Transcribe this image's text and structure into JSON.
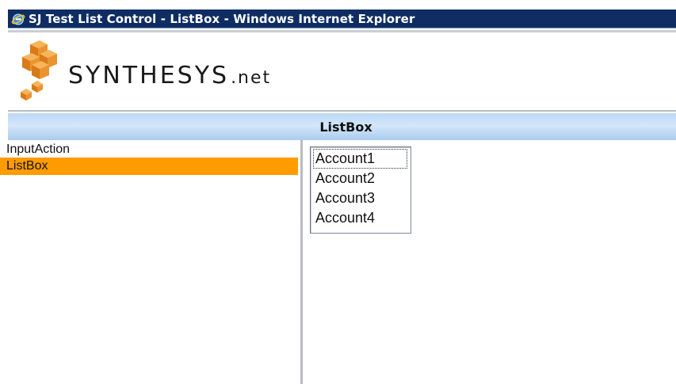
{
  "window": {
    "title": "SJ Test List Control - ListBox - Windows Internet Explorer",
    "title_bar_color": "#0f2d63",
    "icon": "internet-explorer-icon"
  },
  "logo": {
    "icon": "orange-cubes-logo",
    "brand": "SYNTHESYS",
    "suffix": ".net",
    "color": "#f0a030"
  },
  "header": {
    "title": "ListBox",
    "band_color": "#b9d8f4"
  },
  "nav": {
    "items": [
      {
        "label": "InputAction",
        "selected": false
      },
      {
        "label": "ListBox",
        "selected": true
      }
    ],
    "selected_color": "#ff9c00"
  },
  "listbox": {
    "options": [
      "Account1",
      "Account2",
      "Account3",
      "Account4"
    ],
    "focused_index": 0
  }
}
